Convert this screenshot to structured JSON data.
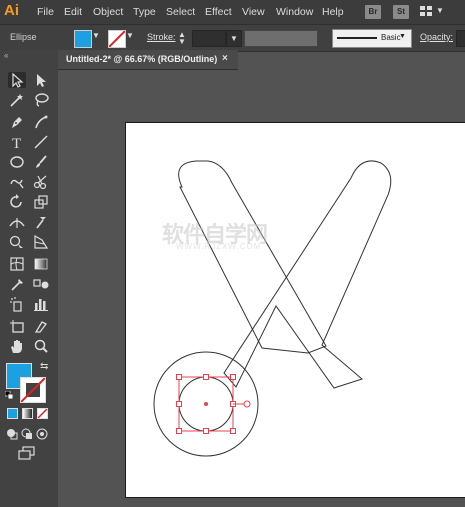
{
  "app": {
    "logo": "Ai"
  },
  "menu": {
    "items": [
      "File",
      "Edit",
      "Object",
      "Type",
      "Select",
      "Effect",
      "View",
      "Window",
      "Help"
    ],
    "bridge_badge": "Br",
    "stock_badge": "St"
  },
  "control_bar": {
    "tool_name": "Ellipse",
    "fill_color": "#1da0e1",
    "stroke_label": "Stroke:",
    "brush_label": "Basic",
    "opacity_label": "Opacity:"
  },
  "document": {
    "tab_title": "Untitled-2* @ 66.67% (RGB/Outline)",
    "close_glyph": "×"
  },
  "tools_panel": {
    "collapse_glyph": "«",
    "fill_color": "#1da0e1",
    "stroke_color": "#ffffff"
  },
  "canvas": {
    "watermark": "软件自学网",
    "watermark_url": "WWW.RJZXW.COM",
    "selection_color": "#e8414b"
  }
}
